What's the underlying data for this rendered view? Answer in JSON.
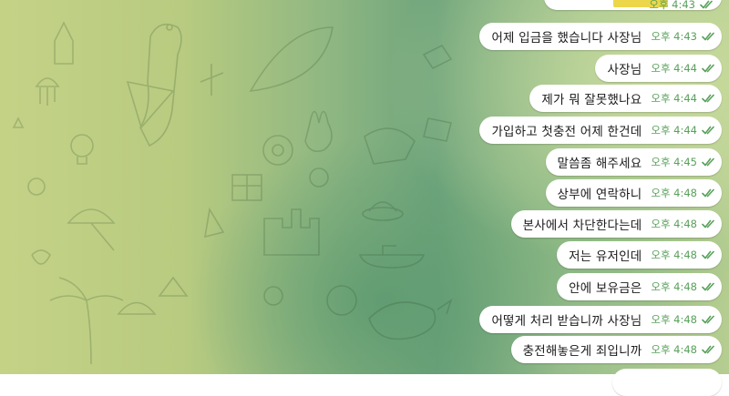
{
  "chat": {
    "top_partial_message": {
      "time": "오후 4:43"
    },
    "messages": [
      {
        "text": "어제 입금을 했습니다 사장님",
        "time": "오후 4:43"
      },
      {
        "text": "사장님",
        "time": "오후 4:44"
      },
      {
        "text": "제가 뭐 잘못했나요",
        "time": "오후 4:44"
      },
      {
        "text": "가입하고 첫충전 어제 한건데",
        "time": "오후 4:44"
      },
      {
        "text": "말씀좀 해주세요",
        "time": "오후 4:45"
      },
      {
        "text": "상부에 연락하니",
        "time": "오후 4:48"
      },
      {
        "text": "본사에서 차단한다는데",
        "time": "오후 4:48"
      },
      {
        "text": "저는 유저인데",
        "time": "오후 4:48"
      },
      {
        "text": "안에 보유금은",
        "time": "오후 4:48"
      },
      {
        "text": "어떻게 처리 받습니까 사장님",
        "time": "오후 4:48"
      },
      {
        "text": "충전해놓은게 죄입니까",
        "time": "오후 4:48"
      }
    ],
    "read_receipt_icon": "double-check-icon",
    "colors": {
      "bubble": "#ffffff",
      "meta": "#58a15a",
      "highlight": "#ecd74a"
    }
  }
}
